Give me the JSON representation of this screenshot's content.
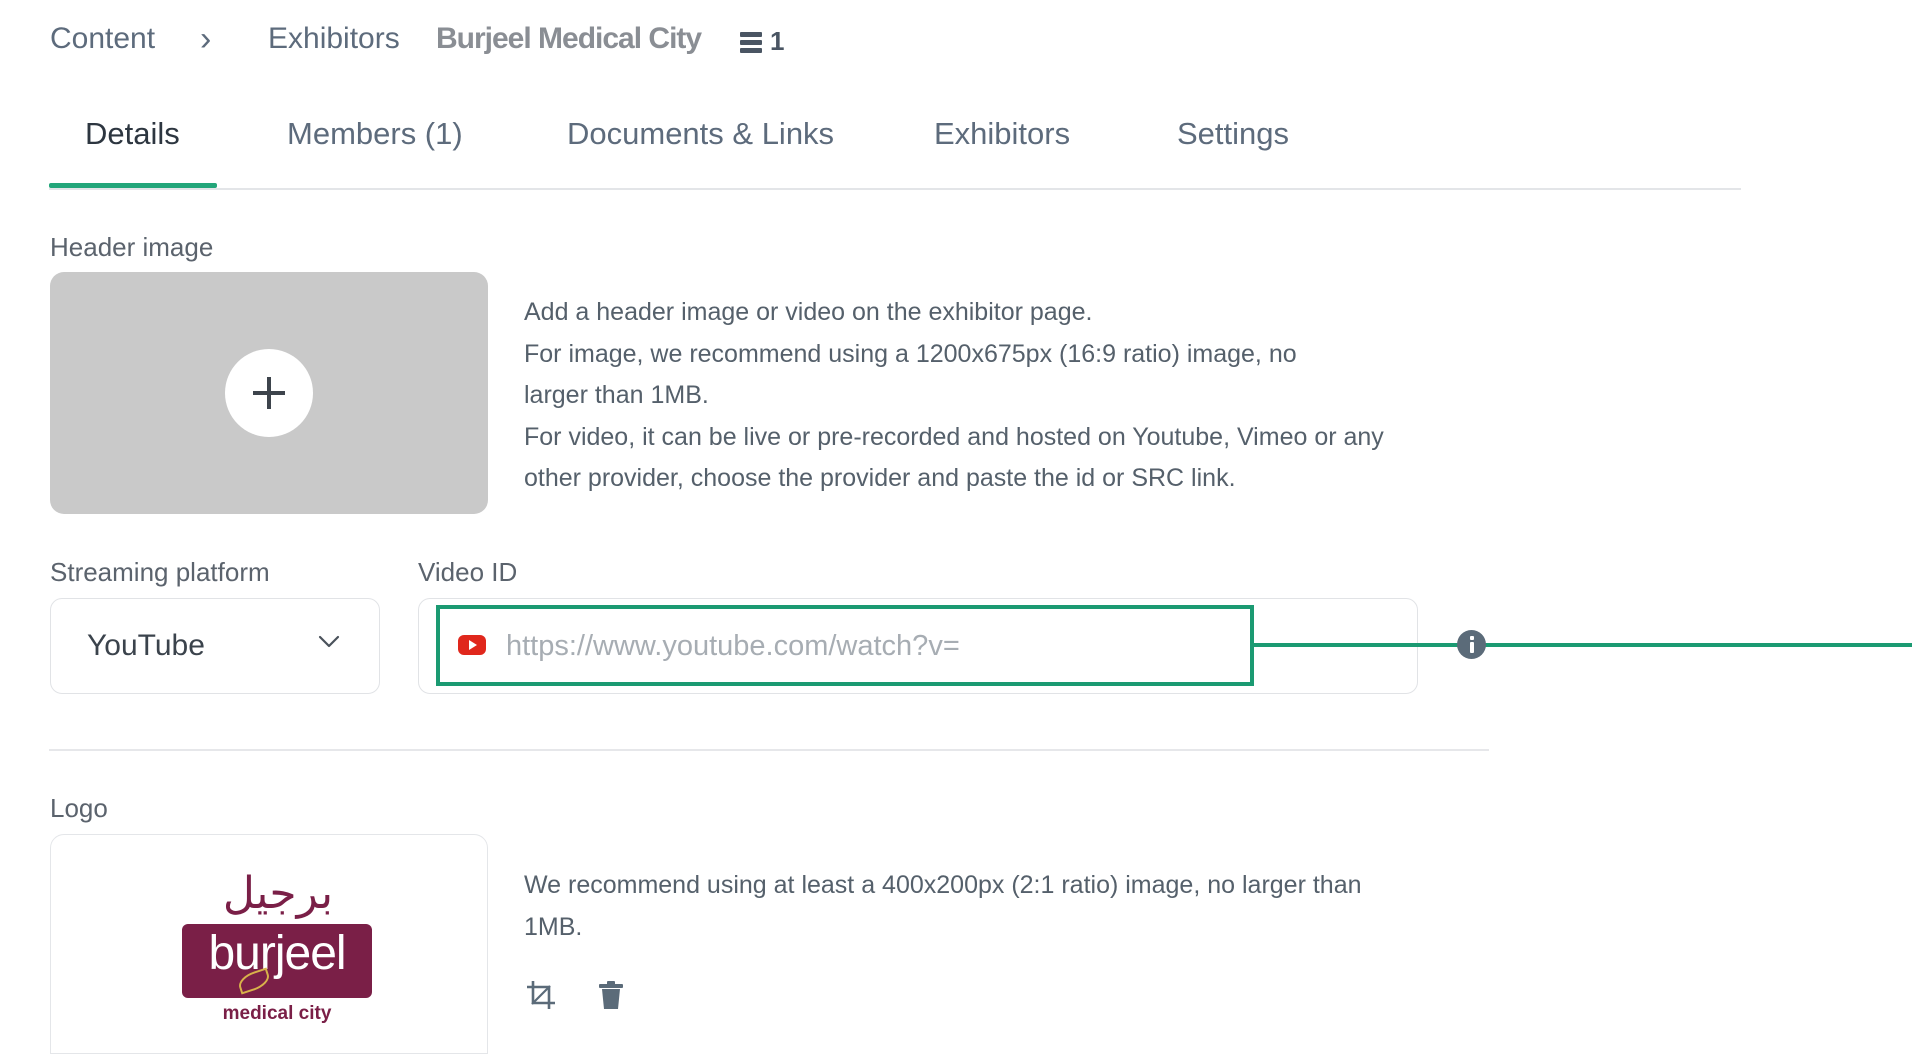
{
  "breadcrumb": {
    "root": "Content",
    "separator": "›",
    "section": "Exhibitors",
    "current": "Burjeel Medical City",
    "count": "1",
    "count_icon": "list-icon"
  },
  "tabs": [
    {
      "label": "Details",
      "active": true
    },
    {
      "label": "Members (1)",
      "active": false
    },
    {
      "label": "Documents & Links",
      "active": false
    },
    {
      "label": "Exhibitors",
      "active": false
    },
    {
      "label": "Settings",
      "active": false
    }
  ],
  "header_image": {
    "label": "Header image",
    "add_icon": "plus-icon",
    "description": [
      "Add a header image or video on the exhibitor page.",
      "For image, we recommend using a 1200x675px (16:9 ratio) image, no larger than 1MB.",
      "For video, it can be live or pre-recorded and hosted on Youtube, Vimeo or any other provider, choose the provider and paste the id or SRC link."
    ]
  },
  "streaming": {
    "label": "Streaming platform",
    "value": "YouTube",
    "icon": "chevron-down-icon"
  },
  "video": {
    "label": "Video ID",
    "value": "",
    "placeholder": "https://www.youtube.com/watch?v=",
    "icon": "youtube-icon",
    "info_icon": "info-icon",
    "highlight_color": "#1b9a72"
  },
  "logo": {
    "label": "Logo",
    "image": {
      "arabic": "برجيل",
      "word": "burjeel",
      "sub": "medical city"
    },
    "description": "We recommend using at least a 400x200px (2:1 ratio) image, no larger than 1MB.",
    "crop_icon": "crop-icon",
    "delete_icon": "trash-icon"
  },
  "colors": {
    "accent": "#23a67a",
    "brand_logo": "#7a1f47"
  }
}
